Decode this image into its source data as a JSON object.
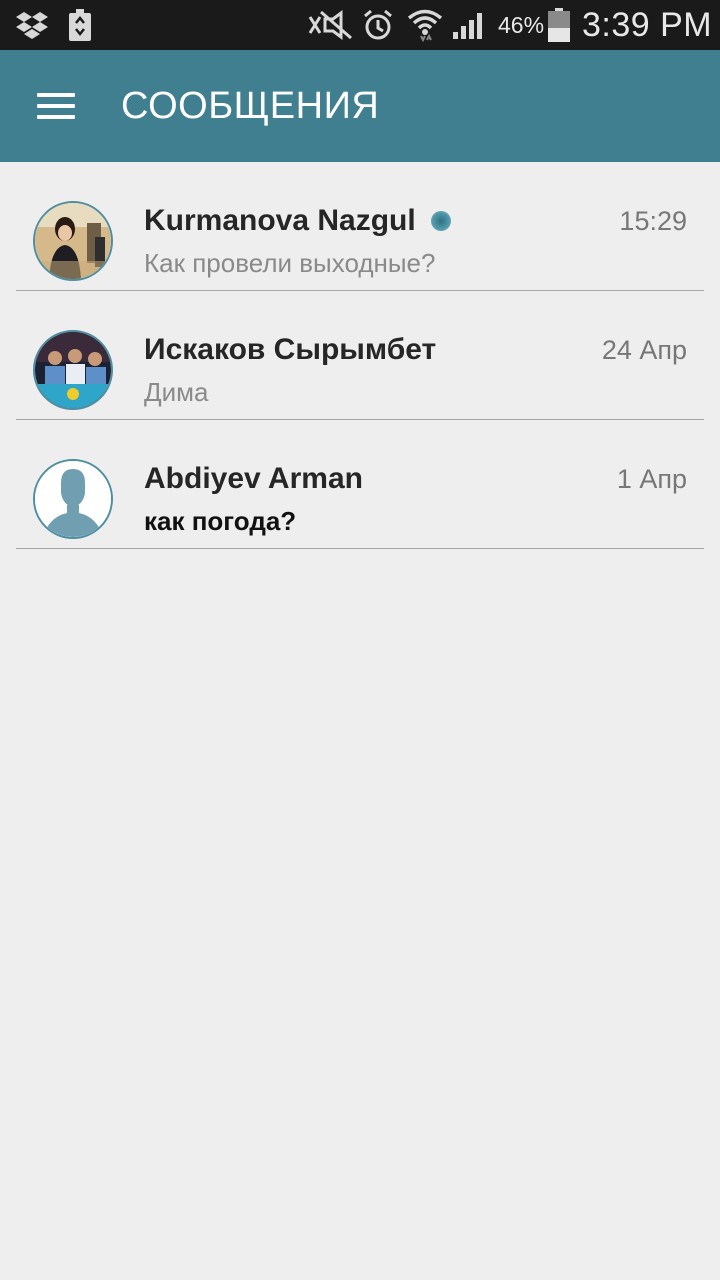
{
  "status_bar": {
    "battery_percent": "46%",
    "time": "3:39 PM",
    "icons": [
      "dropbox-icon",
      "recycle-battery-icon",
      "mute-icon",
      "alarm-icon",
      "wifi-icon",
      "signal-icon",
      "battery-icon"
    ],
    "battery_level": 0.46
  },
  "app_bar": {
    "title": "СООБЩЕНИЯ",
    "menu_icon": "hamburger-menu-icon",
    "color": "#3f7f90"
  },
  "conversations": [
    {
      "name": "Kurmanova Nazgul",
      "preview": "Как провели выходные?",
      "time": "15:29",
      "online": true,
      "unread": false,
      "avatar": "photo-avatar"
    },
    {
      "name": "Искаков Сырымбет",
      "preview": "Дима",
      "time": "24 Апр",
      "online": false,
      "unread": false,
      "avatar": "photo-avatar"
    },
    {
      "name": "Abdiyev Arman",
      "preview": "как погода?",
      "time": "1 Апр",
      "online": false,
      "unread": true,
      "avatar": "default-user-avatar"
    }
  ],
  "colors": {
    "accent": "#3f7f90",
    "online_dot": "#4f97a8",
    "background": "#eeeeee"
  }
}
